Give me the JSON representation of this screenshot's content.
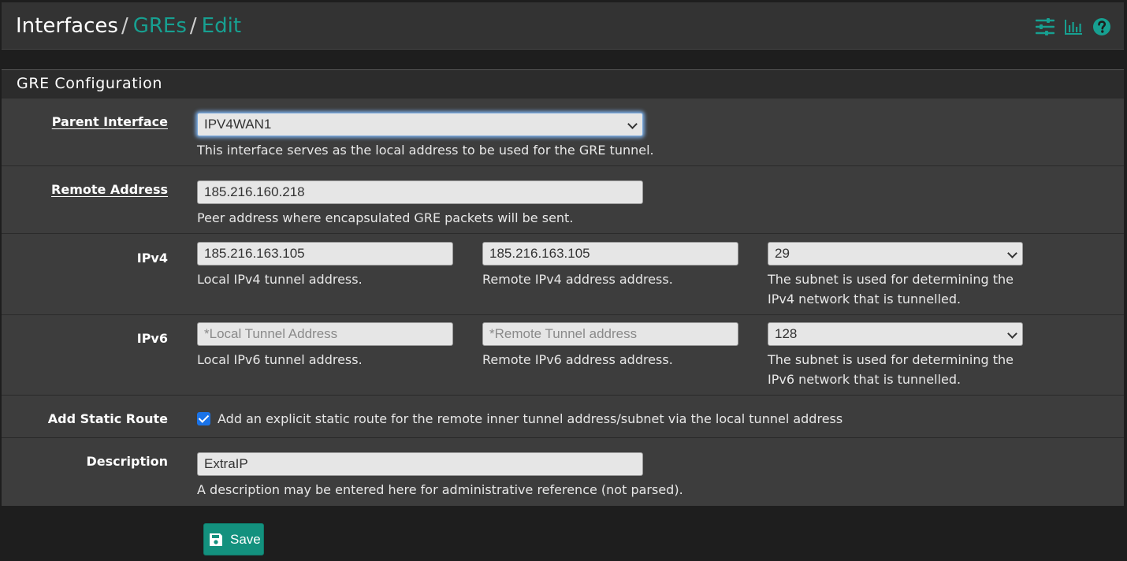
{
  "breadcrumb": {
    "root": "Interfaces",
    "separator": "/",
    "level1": "GREs",
    "level2": "Edit"
  },
  "header_icons": [
    "sliders-icon",
    "bar-chart-icon",
    "help-icon"
  ],
  "panel": {
    "title": "GRE Configuration"
  },
  "parent_interface": {
    "label": "Parent Interface",
    "value": "IPV4WAN1",
    "help": "This interface serves as the local address to be used for the GRE tunnel."
  },
  "remote_address": {
    "label": "Remote Address",
    "value": "185.216.160.218",
    "help": "Peer address where encapsulated GRE packets will be sent."
  },
  "ipv4": {
    "label": "IPv4",
    "local_value": "185.216.163.105",
    "local_help": "Local IPv4 tunnel address.",
    "remote_value": "185.216.163.105",
    "remote_help": "Remote IPv4 address address.",
    "subnet_value": "29",
    "subnet_help_1": "The subnet is used for determining the",
    "subnet_help_2": "IPv4 network that is tunnelled."
  },
  "ipv6": {
    "label": "IPv6",
    "local_placeholder": "*Local Tunnel Address",
    "local_help": "Local IPv6 tunnel address.",
    "remote_placeholder": "*Remote Tunnel address",
    "remote_help": "Remote IPv6 address address.",
    "subnet_value": "128",
    "subnet_help_1": "The subnet is used for determining the",
    "subnet_help_2": "IPv6 network that is tunnelled."
  },
  "static_route": {
    "label": "Add Static Route",
    "checked": true,
    "text": "Add an explicit static route for the remote inner tunnel address/subnet via the local tunnel address"
  },
  "description": {
    "label": "Description",
    "value": "ExtraIP",
    "help": "A description may be entered here for administrative reference (not parsed)."
  },
  "save_button": {
    "label": "Save"
  },
  "colors": {
    "accent": "#17a091",
    "button": "#13917e",
    "checkbox": "#1a73e8"
  }
}
